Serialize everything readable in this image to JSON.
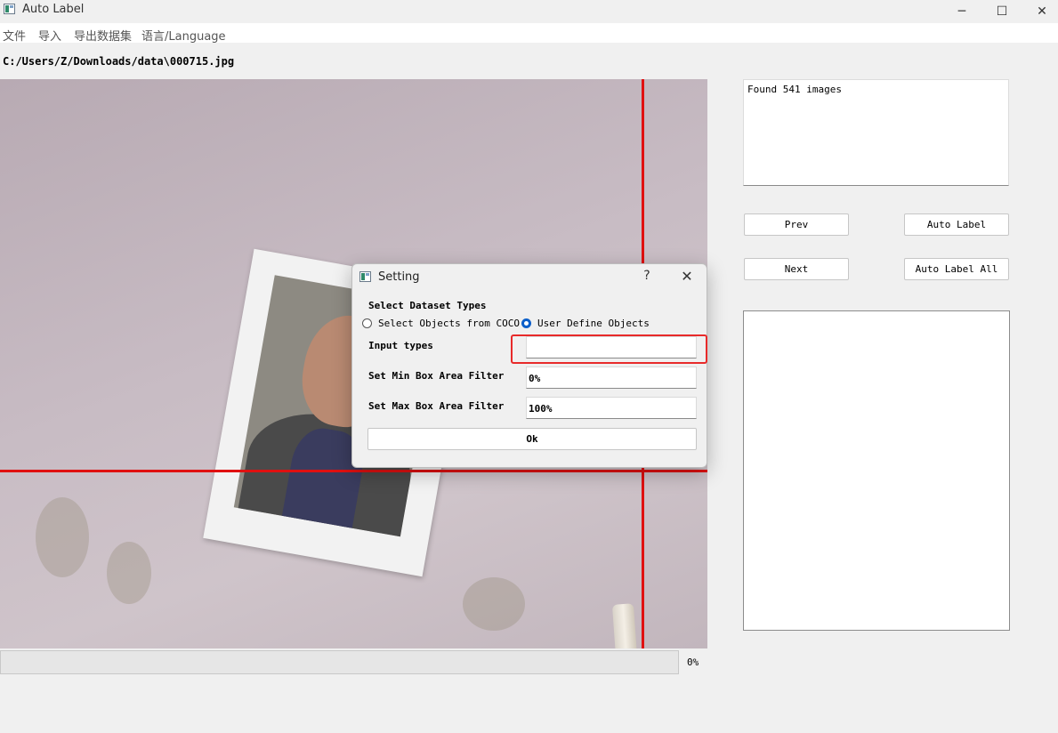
{
  "window": {
    "title": "Auto Label",
    "minimize_glyph": "─",
    "maximize_glyph": "☐",
    "close_glyph": "✕"
  },
  "menu": {
    "items": [
      {
        "label": "文件"
      },
      {
        "label": "导入"
      },
      {
        "label": "导出数据集"
      },
      {
        "label": "语言/Language"
      }
    ]
  },
  "file_path": "C:/Users/Z/Downloads/data\\000715.jpg",
  "progress": {
    "value": 0,
    "text": "0%"
  },
  "log": {
    "text": "Found 541 images"
  },
  "buttons": {
    "prev": "Prev",
    "next": "Next",
    "auto_label": "Auto Label",
    "auto_label_all": "Auto Label All"
  },
  "dialog": {
    "title": "Setting",
    "help_glyph": "?",
    "close_glyph": "✕",
    "dataset_types_label": "Select Dataset Types",
    "radio_coco": {
      "label": "Select Objects from COCO",
      "checked": false
    },
    "radio_user": {
      "label": "User Define Objects",
      "checked": true
    },
    "input_types_label": "Input types",
    "input_types_value": "",
    "min_area_label": "Set Min Box Area Filter",
    "min_area_value": "0%",
    "max_area_label": "Set Max Box Area Filter",
    "max_area_value": "100%",
    "ok_label": "Ok"
  },
  "colors": {
    "annotation_line": "#e01010",
    "highlight": "#e82a2a",
    "radio_selected": "#0b5ec9"
  }
}
